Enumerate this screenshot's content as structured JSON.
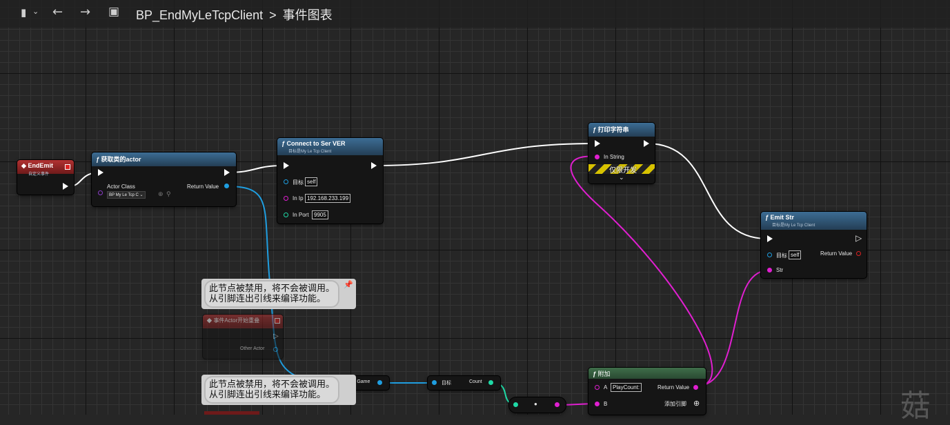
{
  "breadcrumb": {
    "blueprint": "BP_EndMyLeTcpClient",
    "separator": ">",
    "graph": "事件图表"
  },
  "nodes": {
    "end_emit": {
      "title": "EndEmit",
      "subtitle": "自定义事件"
    },
    "get_actor": {
      "title": "获取类的actor",
      "actor_class_label": "Actor Class",
      "actor_class_value": "BP My Le Tcp C",
      "return_label": "Return Value"
    },
    "connect": {
      "title": "Connect to Ser VER",
      "subtitle": "目标是My Le Tcp Client",
      "target_label": "目标",
      "target_value": "self",
      "ip_label": "In Ip",
      "ip_value": "192.168.233.199",
      "port_label": "In Port",
      "port_value": "9905"
    },
    "print": {
      "title": "打印字符串",
      "in_string_label": "In String",
      "dev_only": "仅限开发"
    },
    "emit_str": {
      "title": "Emit Str",
      "subtitle": "目标是My Le Tcp Client",
      "target_label": "目标",
      "target_value": "self",
      "return_label": "Return Value",
      "str_label": "Str"
    },
    "begin_overlap": {
      "title": "事件Actor开始重叠",
      "other_actor_label": "Other Actor"
    },
    "get_game": {
      "target_label": "目标",
      "out_label": "nit Game"
    },
    "count": {
      "target_label": "目标",
      "count_label": "Count"
    },
    "append": {
      "title": "附加",
      "a_label": "A",
      "a_value": "PlayCount:",
      "b_label": "B",
      "return_label": "Return Value",
      "add_pin_label": "添加引脚"
    },
    "convert": {
      "label": "●"
    }
  },
  "comments": {
    "disabled_1": {
      "line1": "此节点被禁用，将不会被调用。",
      "line2": "从引脚连出引线来编译功能。"
    },
    "disabled_2": {
      "line1": "此节点被禁用，将不会被调用。",
      "line2": "从引脚连出引线来编译功能。"
    }
  },
  "watermark": "菇",
  "colors": {
    "exec_wire": "#ffffff",
    "object_wire": "#1f9ee0",
    "string_wire": "#e01fd0",
    "int_wire": "#1fd9a6"
  }
}
